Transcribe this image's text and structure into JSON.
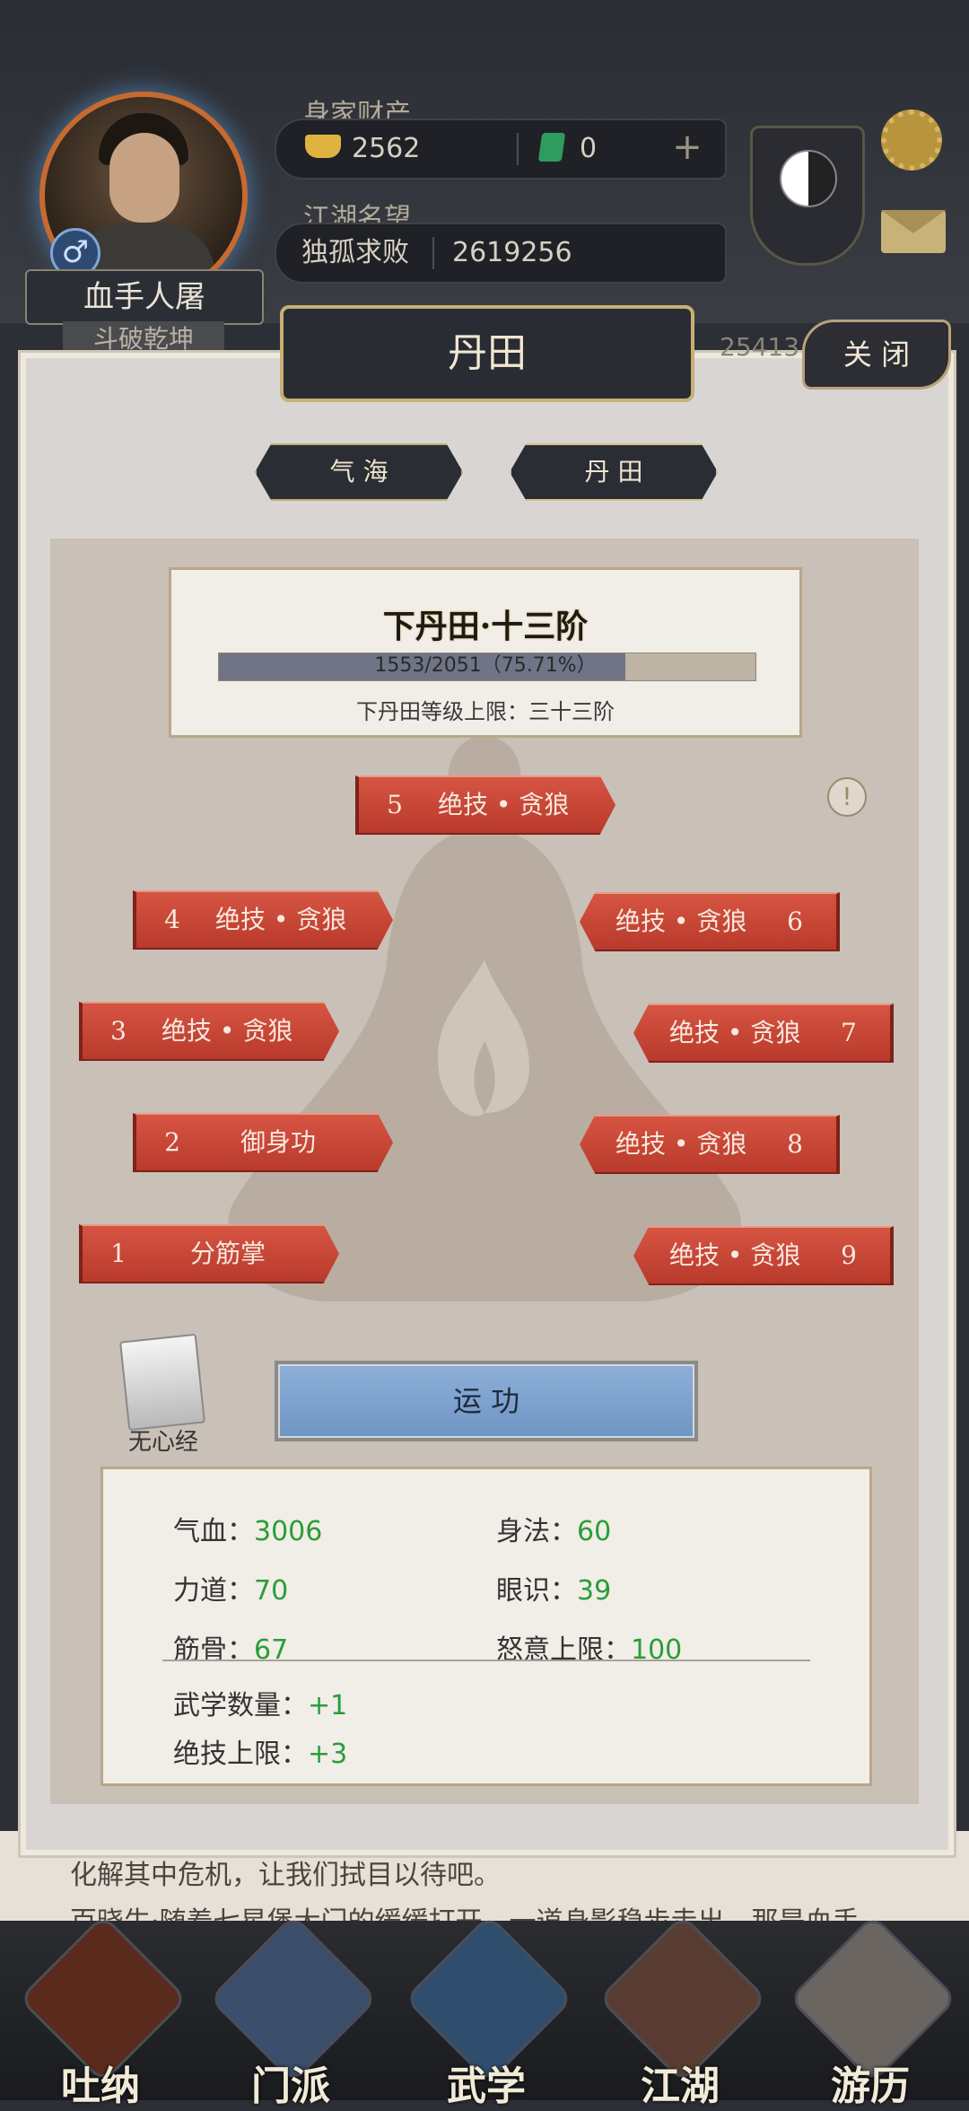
{
  "header": {
    "wealth_label": "身家财产",
    "gold": "2562",
    "jade": "0",
    "plus": "+",
    "reputation_label": "江湖名望",
    "reputation_title": "独孤求败",
    "reputation_value": "2619256",
    "player_name": "血手人屠",
    "player_subtitle": "斗破乾坤",
    "gender_symbol": "♂",
    "partial_value": "25413"
  },
  "modal": {
    "title": "丹田",
    "close_label": "关 闭",
    "tabs": [
      {
        "label": "气 海"
      },
      {
        "label": "丹 田"
      }
    ],
    "level": {
      "title": "下丹田·十三阶",
      "progress_text": "1553/2051（75.71%）",
      "progress_fraction": 0.7571,
      "limit_text": "下丹田等级上限：三十三阶"
    },
    "info_symbol": "!",
    "slots": [
      {
        "num": "5",
        "label": "绝技 • 贪狼"
      },
      {
        "num": "4",
        "label": "绝技 • 贪狼"
      },
      {
        "num": "6",
        "label": "绝技 • 贪狼"
      },
      {
        "num": "3",
        "label": "绝技 • 贪狼"
      },
      {
        "num": "7",
        "label": "绝技 • 贪狼"
      },
      {
        "num": "2",
        "label": "御身功"
      },
      {
        "num": "8",
        "label": "绝技 • 贪狼"
      },
      {
        "num": "1",
        "label": "分筋掌"
      },
      {
        "num": "9",
        "label": "绝技 • 贪狼"
      }
    ],
    "book_label": "无心经",
    "action_button": "运 功",
    "stats": [
      {
        "label": "气血：",
        "value": "3006"
      },
      {
        "label": "身法：",
        "value": "60"
      },
      {
        "label": "力道：",
        "value": "70"
      },
      {
        "label": "眼识：",
        "value": "39"
      },
      {
        "label": "筋骨：",
        "value": "67"
      },
      {
        "label": "怒意上限：",
        "value": "100"
      }
    ],
    "bonuses": [
      {
        "label": "武学数量：",
        "value": "+1"
      },
      {
        "label": "绝技上限：",
        "value": "+3"
      }
    ]
  },
  "story": {
    "line1": "化解其中危机，让我们拭目以待吧。",
    "line2": "百晓生·随着七星堡大门的缓缓打开，一道身影稳步走出，那是血手"
  },
  "nav": [
    {
      "label": "吐纳",
      "icon": "gourd-icon"
    },
    {
      "label": "门派",
      "icon": "banner-icon"
    },
    {
      "label": "武学",
      "icon": "scroll-icon"
    },
    {
      "label": "江湖",
      "icon": "hat-icon"
    },
    {
      "label": "游历",
      "icon": "horse-icon"
    }
  ],
  "colors": {
    "slot_red": "#c94636",
    "stat_green": "#2a9d3a",
    "gold_border": "#c7b074"
  }
}
